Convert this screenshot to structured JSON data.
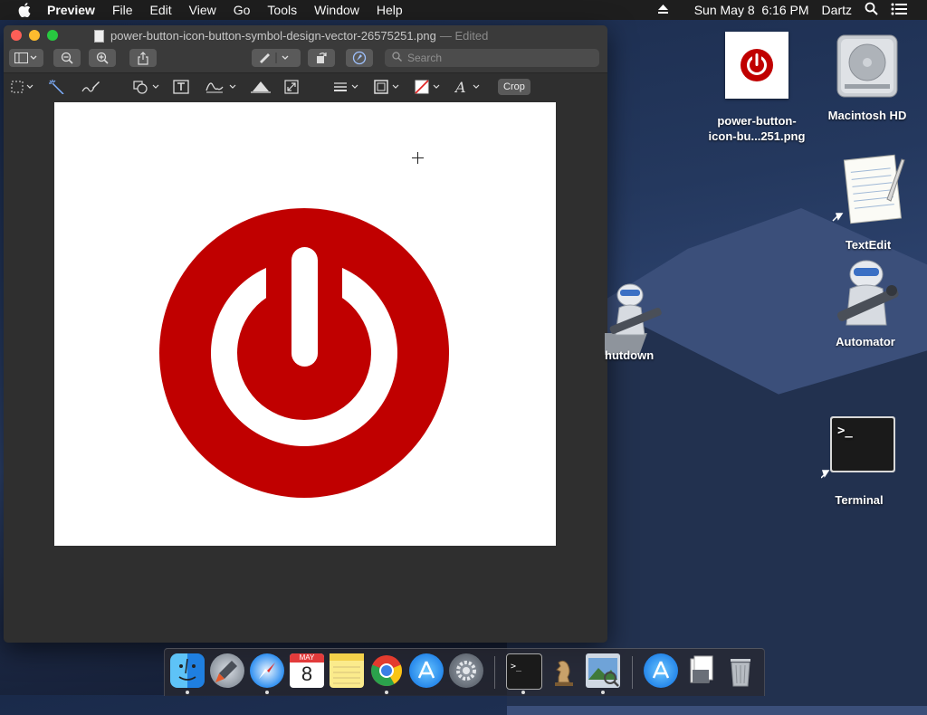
{
  "menubar": {
    "app_name": "Preview",
    "items": [
      "File",
      "Edit",
      "View",
      "Go",
      "Tools",
      "Window",
      "Help"
    ],
    "datetime": "Sun May 8  6:16 PM",
    "user": "Dartz"
  },
  "window": {
    "title": "power-button-icon-button-symbol-design-vector-26575251.png",
    "title_suffix": "— Edited",
    "search_placeholder": "Search",
    "crop_label": "Crop"
  },
  "image": {
    "power_color": "#c00000"
  },
  "desktop_icons": {
    "file": "power-button-icon-bu...251.png",
    "file_line1": "power-button-",
    "file_line2": "icon-bu...251.png",
    "hd": "Macintosh HD",
    "textedit": "TextEdit",
    "shutdown": "hutdown",
    "automator": "Automator",
    "terminal": "Terminal"
  },
  "dock": {
    "calendar_month": "MAY",
    "calendar_day": "8"
  }
}
